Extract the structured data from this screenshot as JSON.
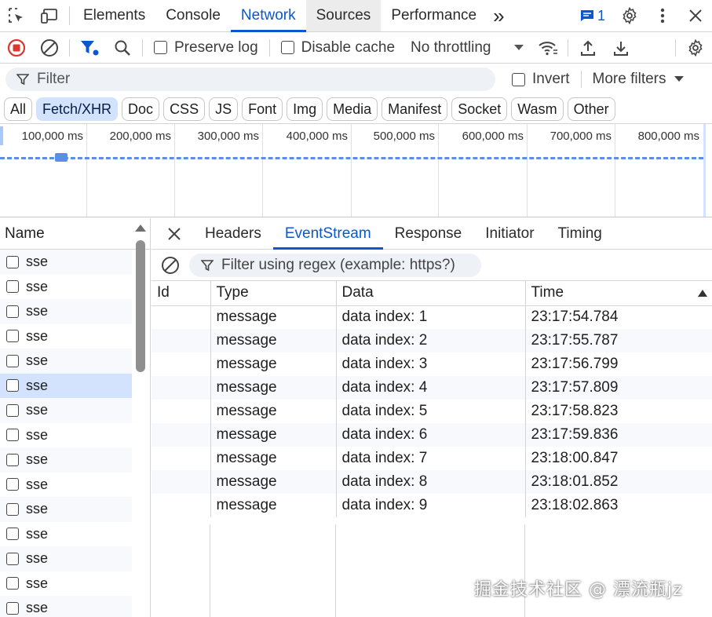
{
  "tabbar": {
    "tabs": [
      {
        "label": "Elements",
        "name": "tab-elements"
      },
      {
        "label": "Console",
        "name": "tab-console"
      },
      {
        "label": "Network",
        "name": "tab-network"
      },
      {
        "label": "Sources",
        "name": "tab-sources"
      },
      {
        "label": "Performance",
        "name": "tab-performance"
      }
    ],
    "active_tab": "Network",
    "more_tabs_glyph": "»",
    "message_count": "1"
  },
  "toolbar": {
    "preserve_log": "Preserve log",
    "disable_cache": "Disable cache",
    "throttling": "No throttling"
  },
  "filter": {
    "placeholder": "Filter",
    "invert": "Invert",
    "more_filters": "More filters"
  },
  "chips": [
    "All",
    "Fetch/XHR",
    "Doc",
    "CSS",
    "JS",
    "Font",
    "Img",
    "Media",
    "Manifest",
    "Socket",
    "Wasm",
    "Other"
  ],
  "active_chip": "Fetch/XHR",
  "overview": {
    "ticks": [
      "100,000 ms",
      "200,000 ms",
      "300,000 ms",
      "400,000 ms",
      "500,000 ms",
      "600,000 ms",
      "700,000 ms",
      "800,000 ms"
    ]
  },
  "requests": {
    "header": "Name",
    "items": [
      "sse",
      "sse",
      "sse",
      "sse",
      "sse",
      "sse",
      "sse",
      "sse",
      "sse",
      "sse",
      "sse",
      "sse",
      "sse",
      "sse",
      "sse"
    ],
    "selected_index": 5
  },
  "detail": {
    "tabs": [
      "Headers",
      "EventStream",
      "Response",
      "Initiator",
      "Timing"
    ],
    "active_tab": "EventStream",
    "filter_placeholder": "Filter using regex (example: https?)",
    "columns": [
      "Id",
      "Type",
      "Data",
      "Time"
    ],
    "rows": [
      {
        "id": "",
        "type": "message",
        "data": "data index: 1",
        "time": "23:17:54.784"
      },
      {
        "id": "",
        "type": "message",
        "data": "data index: 2",
        "time": "23:17:55.787"
      },
      {
        "id": "",
        "type": "message",
        "data": "data index: 3",
        "time": "23:17:56.799"
      },
      {
        "id": "",
        "type": "message",
        "data": "data index: 4",
        "time": "23:17:57.809"
      },
      {
        "id": "",
        "type": "message",
        "data": "data index: 5",
        "time": "23:17:58.823"
      },
      {
        "id": "",
        "type": "message",
        "data": "data index: 6",
        "time": "23:17:59.836"
      },
      {
        "id": "",
        "type": "message",
        "data": "data index: 7",
        "time": "23:18:00.847"
      },
      {
        "id": "",
        "type": "message",
        "data": "data index: 8",
        "time": "23:18:01.852"
      },
      {
        "id": "",
        "type": "message",
        "data": "data index: 9",
        "time": "23:18:02.863"
      }
    ]
  },
  "watermark": "掘金技术社区 @ 漂流瓶jz",
  "colors": {
    "accent": "#0b57d0",
    "record_red": "#dc362e",
    "chip_active": "#d3e3fd",
    "timeline_blue": "#5b8fe6"
  }
}
